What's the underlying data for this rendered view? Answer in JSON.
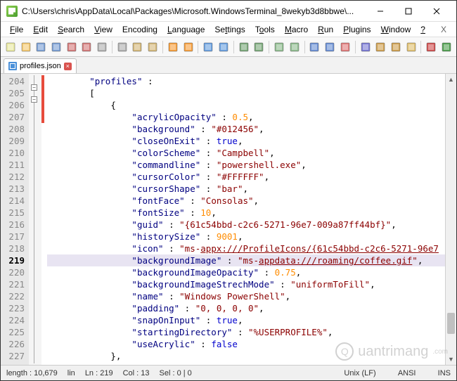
{
  "title": "C:\\Users\\chris\\AppData\\Local\\Packages\\Microsoft.WindowsTerminal_8wekyb3d8bbwe\\...",
  "menu": {
    "file": "File",
    "edit": "Edit",
    "search": "Search",
    "view": "View",
    "encoding": "Encoding",
    "language": "Language",
    "settings": "Settings",
    "tools": "Tools",
    "macro": "Macro",
    "run": "Run",
    "plugins": "Plugins",
    "window": "Window",
    "help": "?",
    "x": "X"
  },
  "tab": {
    "name": "profiles.json",
    "close": "×"
  },
  "lines": {
    "start": 204,
    "end": 227,
    "highlighted": 219
  },
  "code": [
    {
      "n": 204,
      "indent": 8,
      "tokens": [
        [
          "key",
          "\"profiles\""
        ],
        [
          "op",
          " : "
        ]
      ]
    },
    {
      "n": 205,
      "indent": 8,
      "tokens": [
        [
          "punc",
          "["
        ]
      ]
    },
    {
      "n": 206,
      "indent": 12,
      "tokens": [
        [
          "punc",
          "{"
        ]
      ]
    },
    {
      "n": 207,
      "indent": 16,
      "tokens": [
        [
          "key",
          "\"acrylicOpacity\""
        ],
        [
          "op",
          " : "
        ],
        [
          "num",
          "0.5"
        ],
        [
          "punc",
          ","
        ]
      ]
    },
    {
      "n": 208,
      "indent": 16,
      "tokens": [
        [
          "key",
          "\"background\""
        ],
        [
          "op",
          " : "
        ],
        [
          "str",
          "\"#012456\""
        ],
        [
          "punc",
          ","
        ]
      ]
    },
    {
      "n": 209,
      "indent": 16,
      "tokens": [
        [
          "key",
          "\"closeOnExit\""
        ],
        [
          "op",
          " : "
        ],
        [
          "bool",
          "true"
        ],
        [
          "punc",
          ","
        ]
      ]
    },
    {
      "n": 210,
      "indent": 16,
      "tokens": [
        [
          "key",
          "\"colorScheme\""
        ],
        [
          "op",
          " : "
        ],
        [
          "str",
          "\"Campbell\""
        ],
        [
          "punc",
          ","
        ]
      ]
    },
    {
      "n": 211,
      "indent": 16,
      "tokens": [
        [
          "key",
          "\"commandline\""
        ],
        [
          "op",
          " : "
        ],
        [
          "str",
          "\"powershell.exe\""
        ],
        [
          "punc",
          ","
        ]
      ]
    },
    {
      "n": 212,
      "indent": 16,
      "tokens": [
        [
          "key",
          "\"cursorColor\""
        ],
        [
          "op",
          " : "
        ],
        [
          "str",
          "\"#FFFFFF\""
        ],
        [
          "punc",
          ","
        ]
      ]
    },
    {
      "n": 213,
      "indent": 16,
      "tokens": [
        [
          "key",
          "\"cursorShape\""
        ],
        [
          "op",
          " : "
        ],
        [
          "str",
          "\"bar\""
        ],
        [
          "punc",
          ","
        ]
      ]
    },
    {
      "n": 214,
      "indent": 16,
      "tokens": [
        [
          "key",
          "\"fontFace\""
        ],
        [
          "op",
          " : "
        ],
        [
          "str",
          "\"Consolas\""
        ],
        [
          "punc",
          ","
        ]
      ]
    },
    {
      "n": 215,
      "indent": 16,
      "tokens": [
        [
          "key",
          "\"fontSize\""
        ],
        [
          "op",
          " : "
        ],
        [
          "num",
          "10"
        ],
        [
          "punc",
          ","
        ]
      ]
    },
    {
      "n": 216,
      "indent": 16,
      "tokens": [
        [
          "key",
          "\"guid\""
        ],
        [
          "op",
          " : "
        ],
        [
          "str",
          "\"{61c54bbd-c2c6-5271-96e7-009a87ff44bf}\""
        ],
        [
          "punc",
          ","
        ]
      ]
    },
    {
      "n": 217,
      "indent": 16,
      "tokens": [
        [
          "key",
          "\"historySize\""
        ],
        [
          "op",
          " : "
        ],
        [
          "num",
          "9001"
        ],
        [
          "punc",
          ","
        ]
      ]
    },
    {
      "n": 218,
      "indent": 16,
      "tokens": [
        [
          "key",
          "\"icon\""
        ],
        [
          "op",
          " : "
        ],
        [
          "str",
          "\"ms-"
        ],
        [
          "link",
          "appx:///ProfileIcons/{61c54bbd-c2c6-5271-96e7"
        ]
      ]
    },
    {
      "n": 219,
      "indent": 16,
      "tokens": [
        [
          "key",
          "\"backgroundImage\""
        ],
        [
          "op",
          " : "
        ],
        [
          "str",
          "\"ms-"
        ],
        [
          "link",
          "appdata:///roaming/coffee.gif"
        ],
        [
          "str",
          "\""
        ],
        [
          "punc",
          ","
        ]
      ],
      "hl": true
    },
    {
      "n": 220,
      "indent": 16,
      "tokens": [
        [
          "key",
          "\"backgroundImageOpacity\""
        ],
        [
          "op",
          " : "
        ],
        [
          "num",
          "0.75"
        ],
        [
          "punc",
          ","
        ]
      ]
    },
    {
      "n": 221,
      "indent": 16,
      "tokens": [
        [
          "key",
          "\"backgroundImageStrechMode\""
        ],
        [
          "op",
          " : "
        ],
        [
          "str",
          "\"uniformToFill\""
        ],
        [
          "punc",
          ","
        ]
      ]
    },
    {
      "n": 222,
      "indent": 16,
      "tokens": [
        [
          "key",
          "\"name\""
        ],
        [
          "op",
          " : "
        ],
        [
          "str",
          "\"Windows PowerShell\""
        ],
        [
          "punc",
          ","
        ]
      ]
    },
    {
      "n": 223,
      "indent": 16,
      "tokens": [
        [
          "key",
          "\"padding\""
        ],
        [
          "op",
          " : "
        ],
        [
          "str",
          "\"0, 0, 0, 0\""
        ],
        [
          "punc",
          ","
        ]
      ]
    },
    {
      "n": 224,
      "indent": 16,
      "tokens": [
        [
          "key",
          "\"snapOnInput\""
        ],
        [
          "op",
          " : "
        ],
        [
          "bool",
          "true"
        ],
        [
          "punc",
          ","
        ]
      ]
    },
    {
      "n": 225,
      "indent": 16,
      "tokens": [
        [
          "key",
          "\"startingDirectory\""
        ],
        [
          "op",
          " : "
        ],
        [
          "str",
          "\"%USERPROFILE%\""
        ],
        [
          "punc",
          ","
        ]
      ]
    },
    {
      "n": 226,
      "indent": 16,
      "tokens": [
        [
          "key",
          "\"useAcrylic\""
        ],
        [
          "op",
          " : "
        ],
        [
          "bool",
          "false"
        ]
      ]
    },
    {
      "n": 227,
      "indent": 12,
      "tokens": [
        [
          "punc",
          "},"
        ]
      ]
    }
  ],
  "status": {
    "length_label": "length : ",
    "length": "10,679",
    "line_label": "lin",
    "ln_label": "Ln : ",
    "ln": "219",
    "col_label": "Col : ",
    "col": "13",
    "sel_label": "Sel : ",
    "sel": "0 | 0",
    "eol": "Unix (LF)",
    "enc": "ANSI",
    "mode": "INS"
  },
  "toolbar_icons": [
    "new-icon",
    "open-icon",
    "save-icon",
    "save-all-icon",
    "close-icon",
    "close-all-icon",
    "print-icon",
    "sep",
    "cut-icon",
    "copy-icon",
    "paste-icon",
    "sep",
    "undo-icon",
    "redo-icon",
    "sep",
    "find-icon",
    "replace-icon",
    "sep",
    "zoom-in-icon",
    "zoom-out-icon",
    "sep",
    "sync-v-icon",
    "sync-h-icon",
    "sep",
    "wrap-icon",
    "all-chars-icon",
    "indent-guide-icon",
    "sep",
    "lang-icon",
    "doc-map-icon",
    "func-list-icon",
    "folder-icon",
    "sep",
    "record-icon",
    "play-icon"
  ],
  "colors": {
    "new": "#e8e8a0",
    "open": "#f4c870",
    "save": "#7a9fd4",
    "saveall": "#7a9fd4",
    "close": "#d47a7a",
    "closeall": "#d47a7a",
    "print": "#b0b0b0",
    "cut": "#b0b0b0",
    "copy": "#d4b87a",
    "paste": "#d4b87a",
    "undo": "#f79f3c",
    "redo": "#f79f3c",
    "find": "#6aa0e0",
    "replace": "#6aa0e0",
    "zoomin": "#7aa87a",
    "zoomout": "#7aa87a",
    "syncv": "#8fbc8f",
    "synch": "#8fbc8f",
    "wrap": "#6a8fd4",
    "allchars": "#6a8fd4",
    "indent": "#e07a7a",
    "lang": "#7a7ad4",
    "docmap": "#cfa050",
    "funclist": "#cfa050",
    "folder": "#e0c070",
    "record": "#d05050",
    "play": "#50a050"
  },
  "watermark": "uantrimang"
}
